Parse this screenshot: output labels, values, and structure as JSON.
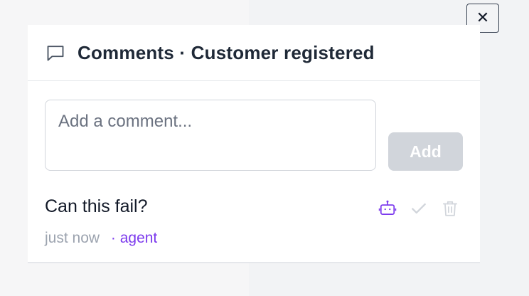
{
  "header": {
    "title": "Comments · Customer registered"
  },
  "composer": {
    "placeholder": "Add a comment...",
    "add_label": "Add"
  },
  "comments": [
    {
      "text": "Can this fail?",
      "time": "just now",
      "author": "· agent",
      "actions": [
        "robot-icon",
        "check-icon",
        "trash-icon"
      ]
    }
  ],
  "colors": {
    "accent": "#7c3aed",
    "disabled_button": "#d1d5db",
    "muted_text": "#9ca3af"
  }
}
